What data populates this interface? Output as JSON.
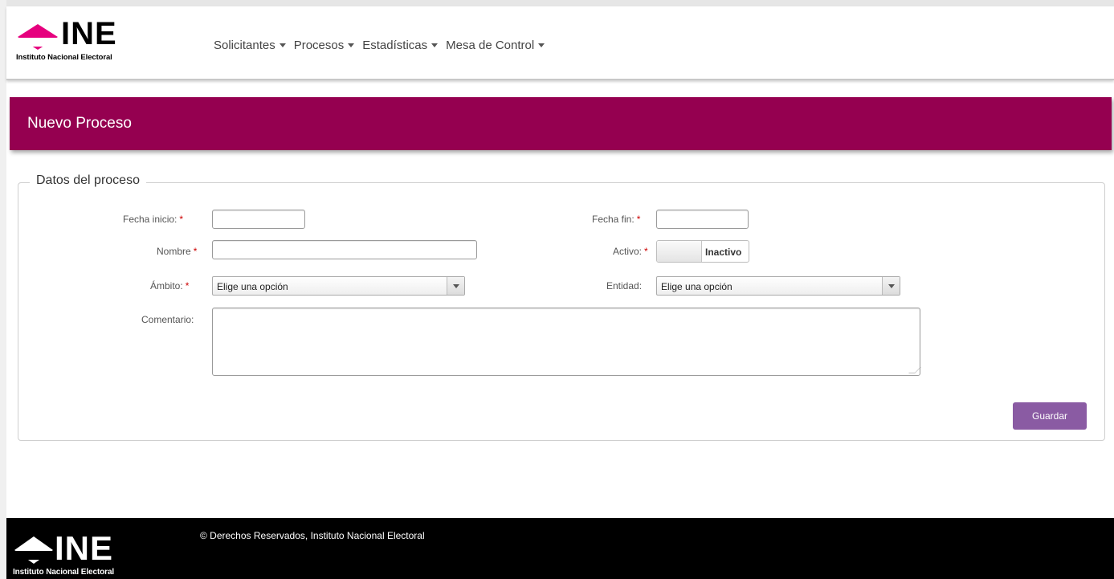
{
  "header": {
    "logo_word": "INE",
    "logo_subtitle": "Instituto Nacional Electoral",
    "nav": [
      {
        "label": "Solicitantes"
      },
      {
        "label": "Procesos"
      },
      {
        "label": "Estadísticas"
      },
      {
        "label": "Mesa de Control"
      }
    ]
  },
  "page": {
    "title": "Nuevo Proceso"
  },
  "form": {
    "legend": "Datos del proceso",
    "fecha_inicio": {
      "label": "Fecha inicio:",
      "required": "*",
      "value": ""
    },
    "fecha_fin": {
      "label": "Fecha fin:",
      "required": "*",
      "value": ""
    },
    "nombre": {
      "label": "Nombre",
      "required": "*",
      "value": ""
    },
    "activo": {
      "label": "Activo:",
      "required": "*",
      "state": "Inactivo"
    },
    "ambito": {
      "label": "Ámbito:",
      "required": "*",
      "selected": "Elige una opción"
    },
    "entidad": {
      "label": "Entidad:",
      "selected": "Elige una opción"
    },
    "comentario": {
      "label": "Comentario:",
      "value": ""
    },
    "save_label": "Guardar"
  },
  "footer": {
    "logo_word": "INE",
    "logo_subtitle": "Instituto Nacional Electoral",
    "copyright": "© Derechos Reservados, Instituto Nacional Electoral"
  },
  "colors": {
    "brand_magenta": "#950050",
    "button_purple": "#8a5ba3",
    "footer_bg": "#000000"
  }
}
